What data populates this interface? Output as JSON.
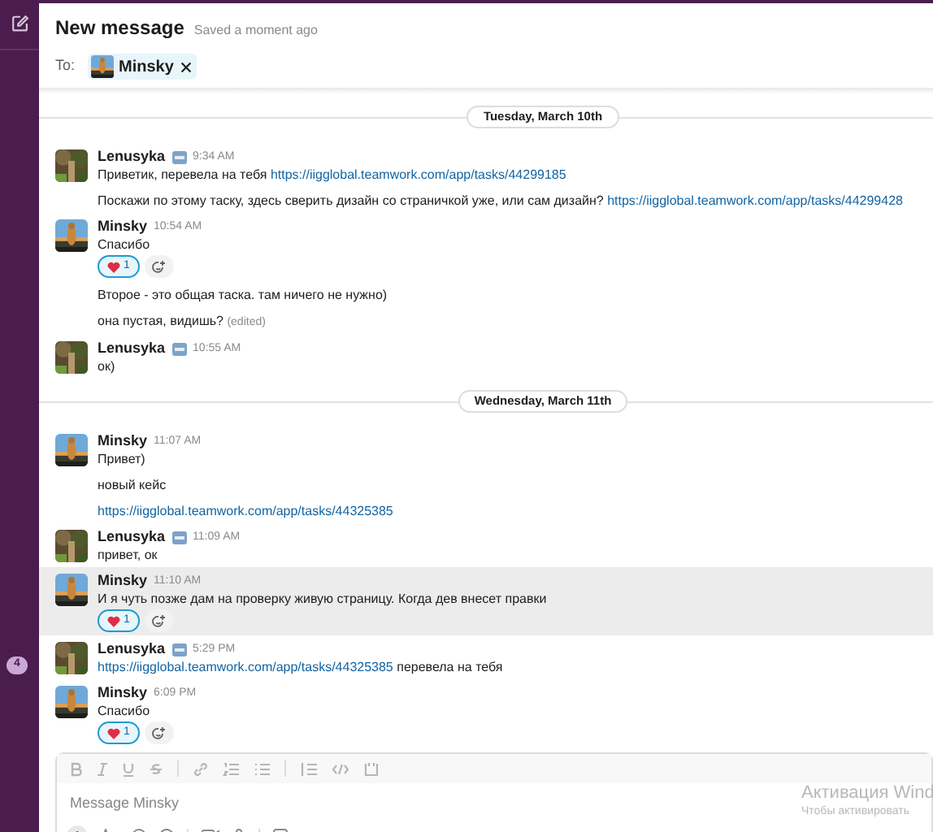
{
  "sidebar": {
    "unread_badge": "4"
  },
  "header": {
    "title": "New message",
    "saved_status": "Saved a moment ago",
    "to_label": "To:",
    "recipient": "Minsky"
  },
  "timeline": [
    {
      "kind": "date",
      "label": "Tuesday, March 10th"
    },
    {
      "kind": "group",
      "author": "Lenusyka",
      "status_emoji": true,
      "time": "9:34 AM",
      "highlighted": false,
      "paragraphs": [
        {
          "segments": [
            {
              "kind": "text",
              "text": "Приветик, перевела на тебя "
            },
            {
              "kind": "link",
              "text": "https://iigglobal.teamwork.com/app/tasks/44299185"
            }
          ]
        },
        {
          "segments": [
            {
              "kind": "text",
              "text": "Поскажи по этому таску, здесь сверить дизайн со страничкой уже, или сам дизайн? "
            },
            {
              "kind": "link",
              "text": "https://iigglobal.teamwork.com/app/tasks/44299428"
            }
          ]
        }
      ]
    },
    {
      "kind": "group",
      "author": "Minsky",
      "status_emoji": false,
      "time": "10:54 AM",
      "highlighted": false,
      "paragraphs": [
        {
          "segments": [
            {
              "kind": "text",
              "text": "Спасибо"
            }
          ],
          "reaction": {
            "count": "1",
            "mine": true
          }
        },
        {
          "segments": [
            {
              "kind": "text",
              "text": "Второе - это общая таска. там ничего не нужно)"
            }
          ]
        },
        {
          "segments": [
            {
              "kind": "text",
              "text": "она пустая, видишь? "
            },
            {
              "kind": "edited",
              "text": "(edited)"
            }
          ]
        }
      ]
    },
    {
      "kind": "group",
      "author": "Lenusyka",
      "status_emoji": true,
      "time": "10:55 AM",
      "highlighted": false,
      "paragraphs": [
        {
          "segments": [
            {
              "kind": "text",
              "text": "ок)"
            }
          ]
        }
      ]
    },
    {
      "kind": "date",
      "label": "Wednesday, March 11th"
    },
    {
      "kind": "group",
      "author": "Minsky",
      "status_emoji": false,
      "time": "11:07 AM",
      "highlighted": false,
      "paragraphs": [
        {
          "segments": [
            {
              "kind": "text",
              "text": "Привет)"
            }
          ]
        },
        {
          "segments": [
            {
              "kind": "text",
              "text": "новый кейс"
            }
          ]
        },
        {
          "segments": [
            {
              "kind": "link",
              "text": "https://iigglobal.teamwork.com/app/tasks/44325385"
            }
          ]
        }
      ]
    },
    {
      "kind": "group",
      "author": "Lenusyka",
      "status_emoji": true,
      "time": "11:09 AM",
      "highlighted": false,
      "paragraphs": [
        {
          "segments": [
            {
              "kind": "text",
              "text": "привет, ок"
            }
          ]
        }
      ]
    },
    {
      "kind": "group",
      "author": "Minsky",
      "status_emoji": false,
      "time": "11:10 AM",
      "highlighted": true,
      "paragraphs": [
        {
          "segments": [
            {
              "kind": "text",
              "text": "И я чуть позже дам на проверку живую страницу. Когда дев внесет правки"
            }
          ],
          "reaction": {
            "count": "1",
            "mine": true
          }
        }
      ]
    },
    {
      "kind": "group",
      "author": "Lenusyka",
      "status_emoji": true,
      "time": "5:29 PM",
      "highlighted": false,
      "paragraphs": [
        {
          "segments": [
            {
              "kind": "link",
              "text": "https://iigglobal.teamwork.com/app/tasks/44325385"
            },
            {
              "kind": "text",
              "text": " перевела на тебя"
            }
          ]
        }
      ]
    },
    {
      "kind": "group",
      "author": "Minsky",
      "status_emoji": false,
      "time": "6:09 PM",
      "highlighted": false,
      "paragraphs": [
        {
          "segments": [
            {
              "kind": "text",
              "text": "Спасибо"
            }
          ],
          "reaction": {
            "count": "1",
            "mine": true
          }
        }
      ]
    }
  ],
  "composer": {
    "placeholder": "Message Minsky"
  },
  "os_overlay": {
    "title": "Активация Wind",
    "subtitle": "Чтобы активировать"
  }
}
